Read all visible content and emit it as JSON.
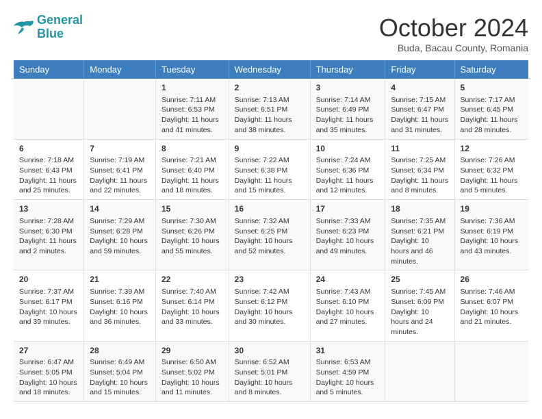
{
  "header": {
    "logo_line1": "General",
    "logo_line2": "Blue",
    "month": "October 2024",
    "location": "Buda, Bacau County, Romania"
  },
  "days_of_week": [
    "Sunday",
    "Monday",
    "Tuesday",
    "Wednesday",
    "Thursday",
    "Friday",
    "Saturday"
  ],
  "weeks": [
    [
      {
        "day": "",
        "info": ""
      },
      {
        "day": "",
        "info": ""
      },
      {
        "day": "1",
        "info": "Sunrise: 7:11 AM\nSunset: 6:53 PM\nDaylight: 11 hours and 41 minutes."
      },
      {
        "day": "2",
        "info": "Sunrise: 7:13 AM\nSunset: 6:51 PM\nDaylight: 11 hours and 38 minutes."
      },
      {
        "day": "3",
        "info": "Sunrise: 7:14 AM\nSunset: 6:49 PM\nDaylight: 11 hours and 35 minutes."
      },
      {
        "day": "4",
        "info": "Sunrise: 7:15 AM\nSunset: 6:47 PM\nDaylight: 11 hours and 31 minutes."
      },
      {
        "day": "5",
        "info": "Sunrise: 7:17 AM\nSunset: 6:45 PM\nDaylight: 11 hours and 28 minutes."
      }
    ],
    [
      {
        "day": "6",
        "info": "Sunrise: 7:18 AM\nSunset: 6:43 PM\nDaylight: 11 hours and 25 minutes."
      },
      {
        "day": "7",
        "info": "Sunrise: 7:19 AM\nSunset: 6:41 PM\nDaylight: 11 hours and 22 minutes."
      },
      {
        "day": "8",
        "info": "Sunrise: 7:21 AM\nSunset: 6:40 PM\nDaylight: 11 hours and 18 minutes."
      },
      {
        "day": "9",
        "info": "Sunrise: 7:22 AM\nSunset: 6:38 PM\nDaylight: 11 hours and 15 minutes."
      },
      {
        "day": "10",
        "info": "Sunrise: 7:24 AM\nSunset: 6:36 PM\nDaylight: 11 hours and 12 minutes."
      },
      {
        "day": "11",
        "info": "Sunrise: 7:25 AM\nSunset: 6:34 PM\nDaylight: 11 hours and 8 minutes."
      },
      {
        "day": "12",
        "info": "Sunrise: 7:26 AM\nSunset: 6:32 PM\nDaylight: 11 hours and 5 minutes."
      }
    ],
    [
      {
        "day": "13",
        "info": "Sunrise: 7:28 AM\nSunset: 6:30 PM\nDaylight: 11 hours and 2 minutes."
      },
      {
        "day": "14",
        "info": "Sunrise: 7:29 AM\nSunset: 6:28 PM\nDaylight: 10 hours and 59 minutes."
      },
      {
        "day": "15",
        "info": "Sunrise: 7:30 AM\nSunset: 6:26 PM\nDaylight: 10 hours and 55 minutes."
      },
      {
        "day": "16",
        "info": "Sunrise: 7:32 AM\nSunset: 6:25 PM\nDaylight: 10 hours and 52 minutes."
      },
      {
        "day": "17",
        "info": "Sunrise: 7:33 AM\nSunset: 6:23 PM\nDaylight: 10 hours and 49 minutes."
      },
      {
        "day": "18",
        "info": "Sunrise: 7:35 AM\nSunset: 6:21 PM\nDaylight: 10 hours and 46 minutes."
      },
      {
        "day": "19",
        "info": "Sunrise: 7:36 AM\nSunset: 6:19 PM\nDaylight: 10 hours and 43 minutes."
      }
    ],
    [
      {
        "day": "20",
        "info": "Sunrise: 7:37 AM\nSunset: 6:17 PM\nDaylight: 10 hours and 39 minutes."
      },
      {
        "day": "21",
        "info": "Sunrise: 7:39 AM\nSunset: 6:16 PM\nDaylight: 10 hours and 36 minutes."
      },
      {
        "day": "22",
        "info": "Sunrise: 7:40 AM\nSunset: 6:14 PM\nDaylight: 10 hours and 33 minutes."
      },
      {
        "day": "23",
        "info": "Sunrise: 7:42 AM\nSunset: 6:12 PM\nDaylight: 10 hours and 30 minutes."
      },
      {
        "day": "24",
        "info": "Sunrise: 7:43 AM\nSunset: 6:10 PM\nDaylight: 10 hours and 27 minutes."
      },
      {
        "day": "25",
        "info": "Sunrise: 7:45 AM\nSunset: 6:09 PM\nDaylight: 10 hours and 24 minutes."
      },
      {
        "day": "26",
        "info": "Sunrise: 7:46 AM\nSunset: 6:07 PM\nDaylight: 10 hours and 21 minutes."
      }
    ],
    [
      {
        "day": "27",
        "info": "Sunrise: 6:47 AM\nSunset: 5:05 PM\nDaylight: 10 hours and 18 minutes."
      },
      {
        "day": "28",
        "info": "Sunrise: 6:49 AM\nSunset: 5:04 PM\nDaylight: 10 hours and 15 minutes."
      },
      {
        "day": "29",
        "info": "Sunrise: 6:50 AM\nSunset: 5:02 PM\nDaylight: 10 hours and 11 minutes."
      },
      {
        "day": "30",
        "info": "Sunrise: 6:52 AM\nSunset: 5:01 PM\nDaylight: 10 hours and 8 minutes."
      },
      {
        "day": "31",
        "info": "Sunrise: 6:53 AM\nSunset: 4:59 PM\nDaylight: 10 hours and 5 minutes."
      },
      {
        "day": "",
        "info": ""
      },
      {
        "day": "",
        "info": ""
      }
    ]
  ]
}
